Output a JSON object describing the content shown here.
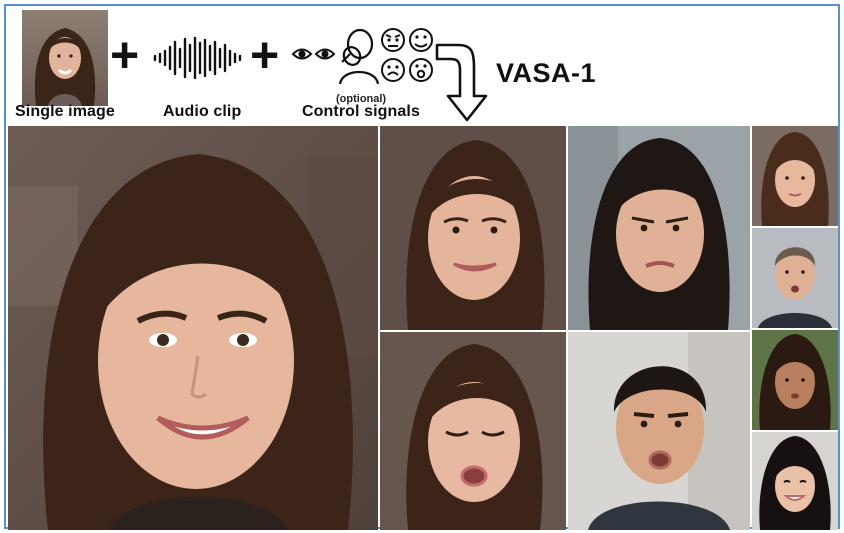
{
  "header": {
    "input_image_label": "Single image",
    "audio_label": "Audio clip",
    "optional_label": "(optional)",
    "control_label": "Control signals",
    "model_name": "VASA-1",
    "plus_symbol": "+"
  },
  "icons": {
    "eyes": "eyes-icon",
    "head_pose": "head-pose-icon",
    "emotions": "emotion-faces-icon",
    "arrow": "curved-arrow-icon",
    "waveform": "audio-waveform-icon"
  },
  "colors": {
    "border": "#5a8fd6",
    "text": "#111111",
    "background": "#ffffff"
  }
}
